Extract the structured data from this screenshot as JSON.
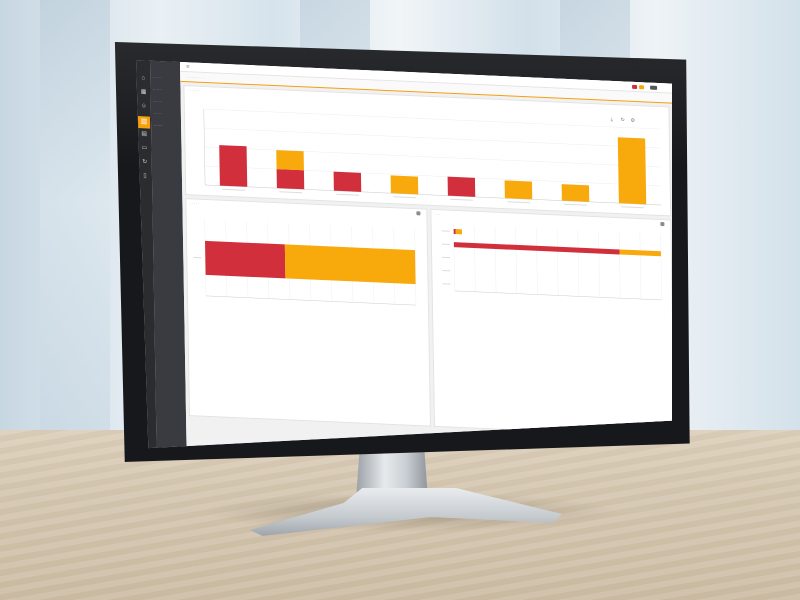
{
  "colors": {
    "accent": "#f5a00c",
    "series_red": "#d22f3c",
    "series_orange": "#f8a90c",
    "rail_bg": "#2b2c30",
    "nav_bg": "#3a3b40"
  },
  "rail": {
    "icons": [
      "home-icon",
      "calendar-icon",
      "users-icon",
      "chart-icon",
      "document-icon",
      "folder-icon",
      "refresh-icon",
      "file-icon"
    ],
    "active_index": 3
  },
  "nav": {
    "items": [
      {
        "label": "··········"
      },
      {
        "label": "··········"
      },
      {
        "label": "··········"
      },
      {
        "label": "··········"
      },
      {
        "label": "··········"
      }
    ],
    "active_index": 4
  },
  "header": {
    "menu_icon": "menu-icon",
    "status_colors": [
      "#d22f3c",
      "#f8a90c",
      "#555555"
    ]
  },
  "chart_data": [
    {
      "type": "bar",
      "stacked": true,
      "categories": [
        "",
        "",
        "",
        "",
        "",
        "",
        "",
        ""
      ],
      "series": [
        {
          "values": [
            32,
            15,
            15,
            0,
            15,
            0,
            0,
            0
          ]
        },
        {
          "values": [
            0,
            15,
            0,
            14,
            0,
            14,
            13,
            52
          ]
        }
      ],
      "ylim": [
        0,
        60
      ],
      "grid": true
    },
    {
      "type": "bar",
      "orientation": "horizontal",
      "stacked": true,
      "categories": [
        ""
      ],
      "series": [
        {
          "values": [
            38
          ]
        },
        {
          "values": [
            62
          ]
        }
      ],
      "xlim": [
        0,
        100
      ],
      "grid": true
    },
    {
      "type": "bar",
      "orientation": "horizontal",
      "stacked": true,
      "categories": [
        "",
        "",
        "",
        "",
        ""
      ],
      "series": [
        {
          "values": [
            1,
            80,
            0,
            0,
            0
          ]
        },
        {
          "values": [
            3,
            20,
            0,
            0,
            0
          ]
        }
      ],
      "xlim": [
        0,
        100
      ],
      "grid": true
    }
  ]
}
